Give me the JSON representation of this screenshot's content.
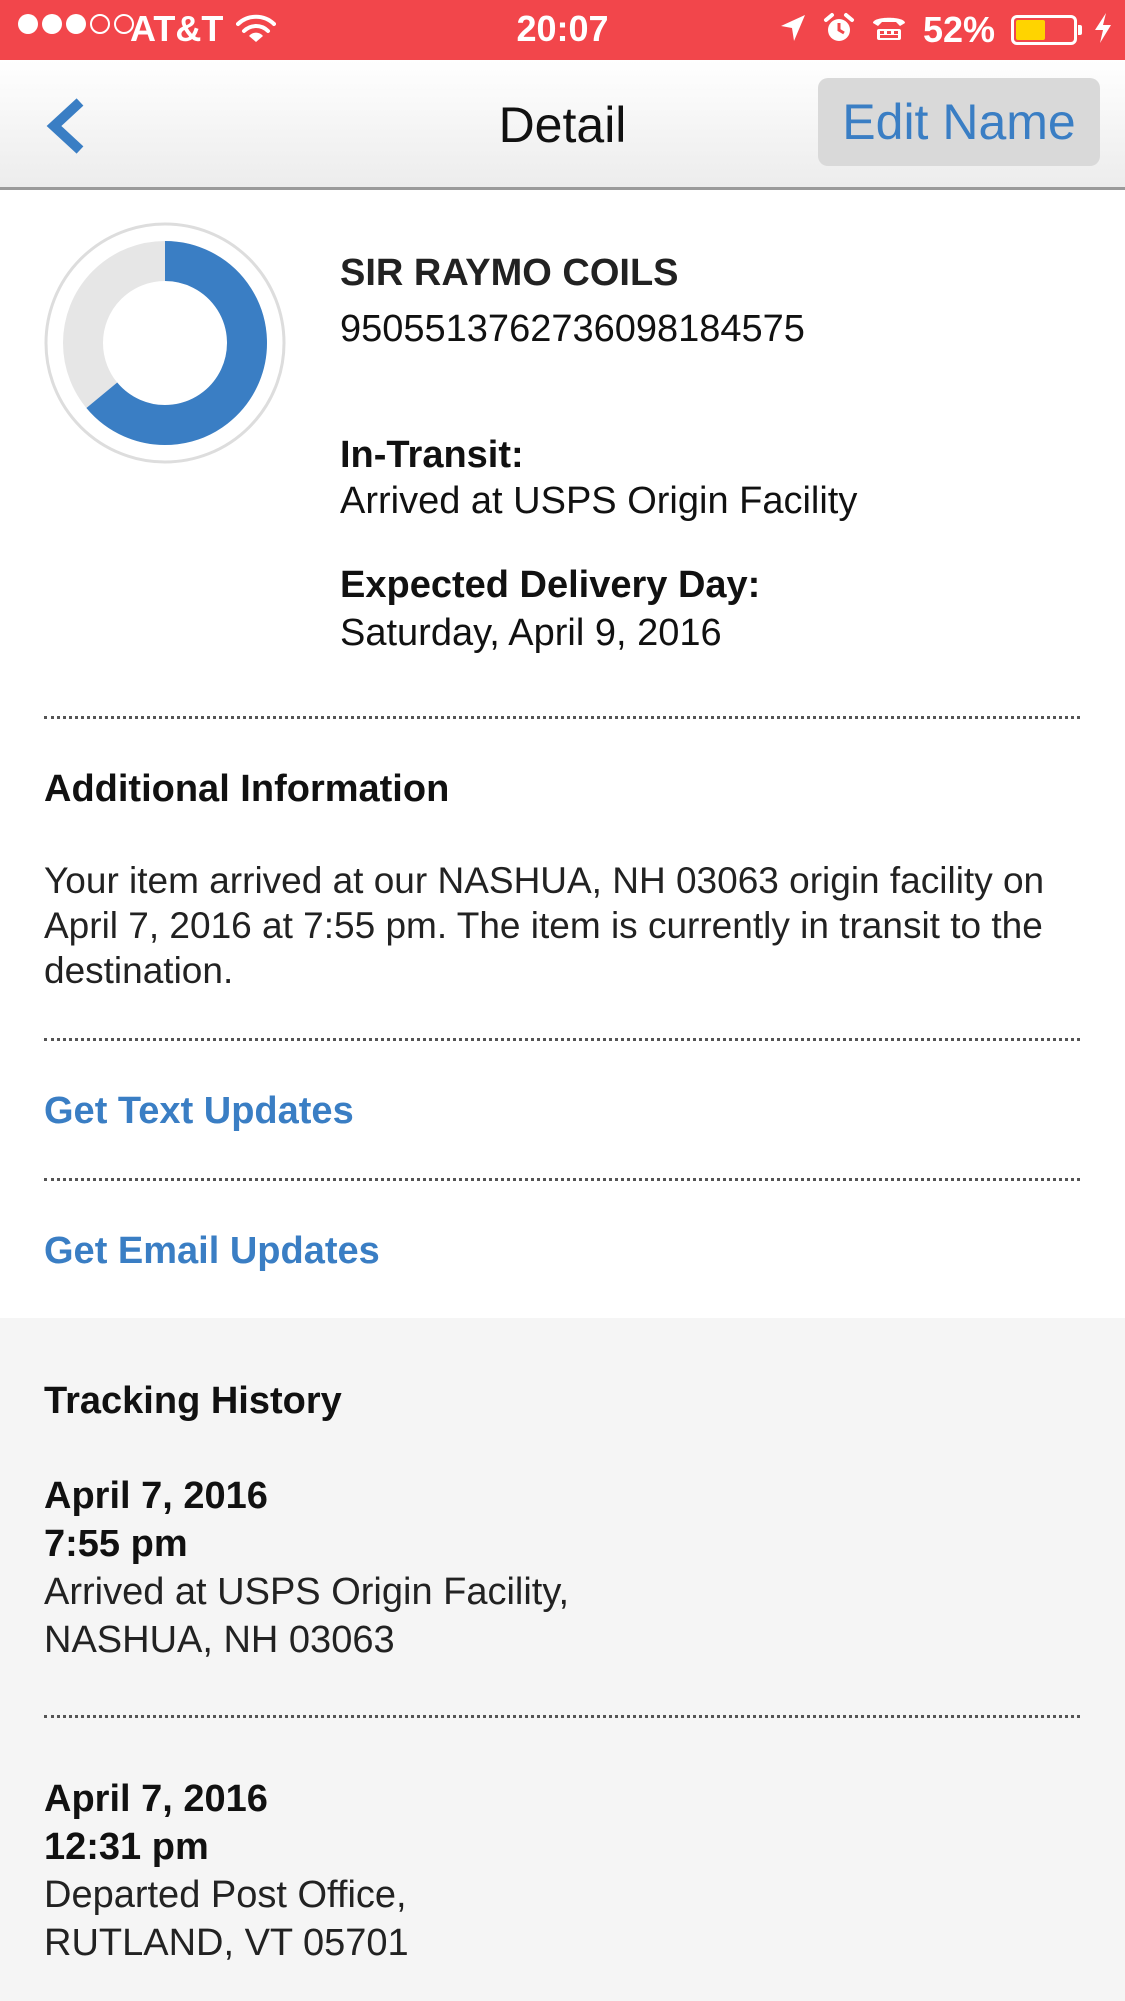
{
  "status_bar": {
    "carrier": "AT&T",
    "time": "20:07",
    "battery_percent": "52%",
    "battery_level": 0.52,
    "signal_bars_filled": 3,
    "signal_bars_total": 5,
    "icons": [
      "signal-dots-icon",
      "wifi-icon",
      "location-arrow-icon",
      "alarm-icon",
      "tty-icon",
      "battery-icon",
      "charging-bolt-icon"
    ],
    "color": "#f2464b"
  },
  "nav": {
    "title": "Detail",
    "back_icon": "chevron-left-icon",
    "edit_label": "Edit Name"
  },
  "summary": {
    "progress_fraction": 0.64,
    "progress_color": "#3a7ec4",
    "item_name": "SIR RAYMO COILS",
    "tracking_number": "9505513762736098184575",
    "status_label": "In-Transit:",
    "status_text": "Arrived at USPS Origin Facility",
    "delivery_label": "Expected Delivery Day:",
    "delivery_date": "Saturday, April 9, 2016"
  },
  "additional": {
    "heading": "Additional Information",
    "text": "Your item arrived at our NASHUA, NH 03063 origin facility on April 7, 2016 at 7:55 pm. The item is currently in transit to the destination."
  },
  "links": {
    "text_updates": "Get Text Updates",
    "email_updates": "Get Email Updates",
    "color": "#3a7ec4"
  },
  "history": {
    "heading": "Tracking History",
    "events": [
      {
        "date": "April 7, 2016",
        "time": "7:55 pm",
        "description": "Arrived at USPS Origin Facility,",
        "location": "NASHUA, NH 03063"
      },
      {
        "date": "April 7, 2016",
        "time": "12:31 pm",
        "description": "Departed Post Office,",
        "location": "RUTLAND, VT 05701"
      }
    ]
  }
}
